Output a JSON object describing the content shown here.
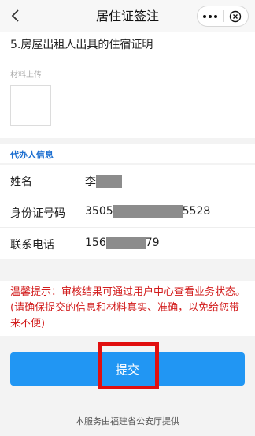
{
  "nav": {
    "title": "居住证签注",
    "back_icon": "chevron-left-icon",
    "more_icon": "more-dots-icon",
    "close_icon": "close-circle-icon"
  },
  "document": {
    "title": "5.房屋出租人出具的住宿证明",
    "upload_label": "材料上传",
    "upload_icon": "plus-icon"
  },
  "agent": {
    "section_title": "代办人信息",
    "rows": [
      {
        "label": "姓名",
        "value_prefix": "李",
        "value_suffix": ""
      },
      {
        "label": "身份证号码",
        "value_prefix": "3505",
        "value_suffix": "5528"
      },
      {
        "label": "联系电话",
        "value_prefix": "156",
        "value_suffix": "79"
      }
    ]
  },
  "notice": {
    "text": "温馨提示：审核结果可通过用户中心查看业务状态。(请确保提交的信息和材料真实、准确，以免给您带来不便)"
  },
  "submit": {
    "label": "提交"
  },
  "footer": {
    "text": "本服务由福建省公安厅提供"
  },
  "colors": {
    "accent": "#2196f3",
    "section_title": "#1d6fd0",
    "notice": "#d21d1d",
    "highlight": "#e10f0f"
  }
}
